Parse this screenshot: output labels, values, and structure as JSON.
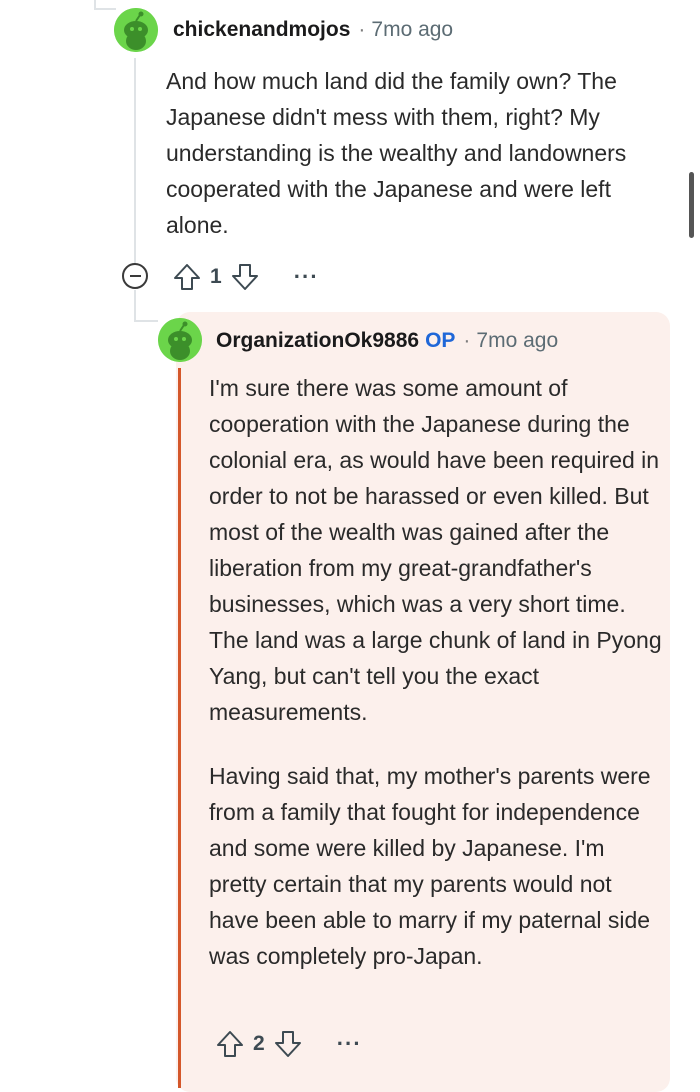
{
  "comments": [
    {
      "username": "chickenandmojos",
      "separator": "·",
      "time": "7mo ago",
      "paragraphs": [
        "And how much land did the family own? The Japanese didn't mess with them, right? My understanding is the wealthy and landowners cooperated with the Japanese and were left alone."
      ],
      "votes": "1",
      "more": "···"
    },
    {
      "username": "OrganizationOk9886",
      "badge": "OP",
      "separator": "·",
      "time": "7mo ago",
      "paragraphs": [
        "I'm sure there was some amount of cooperation with the Japanese during the colonial era, as would have been required in order to not be harassed or even killed. But most of the wealth was gained after the liberation from my great-grandfather's businesses, which was a very short time. The land was a large chunk of land in Pyong Yang, but can't tell you the exact measurements.",
        "Having said that, my mother's parents were from a family that fought for independence and some were killed by Japanese. I'm pretty certain that my parents would not have been able to marry if my paternal side was completely pro-Japan."
      ],
      "votes": "2",
      "more": "···"
    }
  ],
  "colors": {
    "avatar_green": "#6bd54a",
    "op_blue": "#1f67d8",
    "highlight_bg": "#fcf0ec",
    "highlight_bar": "#d4572a"
  },
  "icons": [
    "snoo-avatar-icon",
    "upvote-icon",
    "downvote-icon",
    "collapse-icon",
    "more-icon"
  ]
}
